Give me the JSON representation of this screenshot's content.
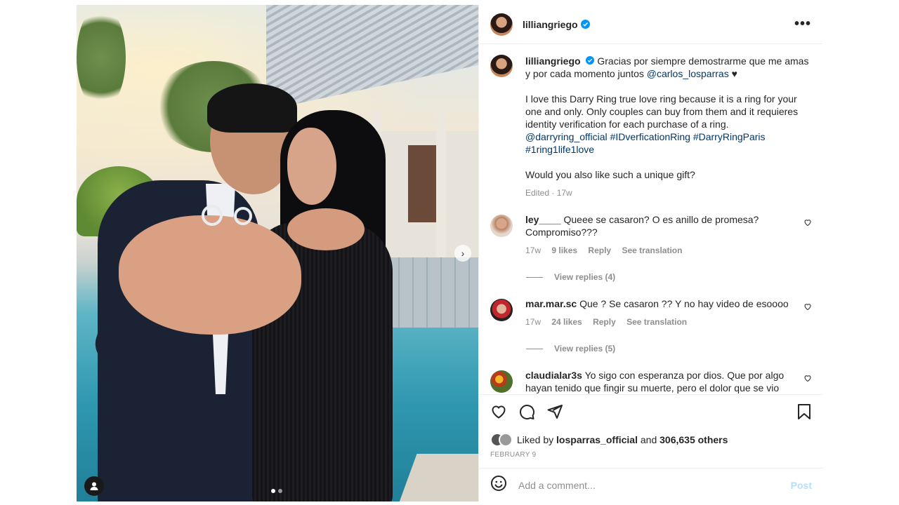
{
  "post": {
    "author": "lilliangriego",
    "more_icon": "more-horizontal-icon",
    "carousel": {
      "current": 1,
      "total": 2
    }
  },
  "caption": {
    "username": "lilliangriego",
    "text_1": "Gracias por siempre demostrarme que me amas y por cada momento juntos",
    "mention_1": "@carlos_losparras",
    "heart": "♥",
    "text_2": "I love this Darry Ring true love ring because it is a ring for your one and only. Only couples can buy from them and it requieres identity verification for each purchase of a ring.",
    "mention_2": "@darryring_official",
    "hashtags": "#IDverficationRing #DarryRingParis",
    "hashtag_3": "#1ring1life1love",
    "text_3": "Would you also like such a unique gift?",
    "meta": "Edited · 17w"
  },
  "comments": [
    {
      "username": "ley____",
      "text": "Queee se casaron? O es anillo de promesa? Compromiso???",
      "time": "17w",
      "likes": "9 likes",
      "reply": "Reply",
      "translate": "See translation",
      "view_replies": "View replies (4)"
    },
    {
      "username": "mar.mar.sc",
      "text": "Que ? Se casaron ?? Y no hay video de esoooo",
      "time": "17w",
      "likes": "24 likes",
      "reply": "Reply",
      "translate": "See translation",
      "view_replies": "View replies (5)"
    },
    {
      "username": "claudialar3s",
      "text": "Yo sigo con esperanza por dios. Que por algo hayan tenido que fingir su muerte, pero el dolor que se vio no"
    }
  ],
  "likes": {
    "prefix": "Liked by",
    "user": "losparras_official",
    "middle": "and",
    "others": "306,635 others"
  },
  "date": "FEBRUARY 9",
  "add_comment": {
    "placeholder": "Add a comment...",
    "post_label": "Post"
  },
  "colors": {
    "link": "#00376b",
    "verified": "#0095f6",
    "muted": "#8e8e8e",
    "post_disabled": "#b2dffc"
  }
}
